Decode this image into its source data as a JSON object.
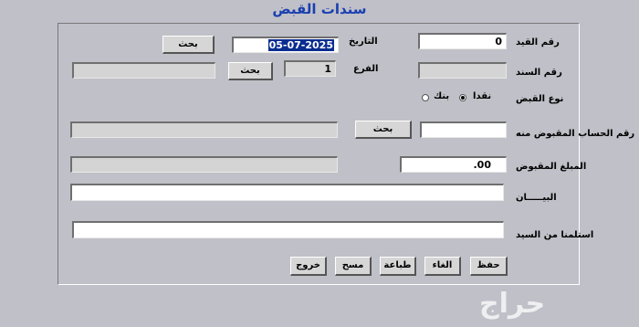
{
  "window": {
    "title": "سندات القبض"
  },
  "form": {
    "entry_no_label": "رقم القيد",
    "entry_no_value": "0",
    "date_label": "التاريخ",
    "date_value": "05-07-2025",
    "search_label": "بحث",
    "bond_no_label": "رقم السند",
    "bond_no_value": "",
    "branch_label": "الفرع",
    "branch_value": "1",
    "branch_name_value": "",
    "receipt_type_label": "نوع القبض",
    "cash_label": "نقدا",
    "bank_label": "بنك",
    "account_label": "رقم الحساب المقبوض منه",
    "account_no_value": "",
    "account_name_value": "",
    "amount_label": "المبلغ المقبوض",
    "amount_value": ".00",
    "amount_words_value": "",
    "statement_label": "البيـــــان",
    "statement_value": "",
    "received_from_label": "استلمنا من السيد",
    "received_from_value": ""
  },
  "buttons": {
    "save": "حفظ",
    "cancel": "الغاء",
    "print": "طباعة",
    "clear": "مسح",
    "exit": "خروج"
  },
  "watermark": "حراج"
}
